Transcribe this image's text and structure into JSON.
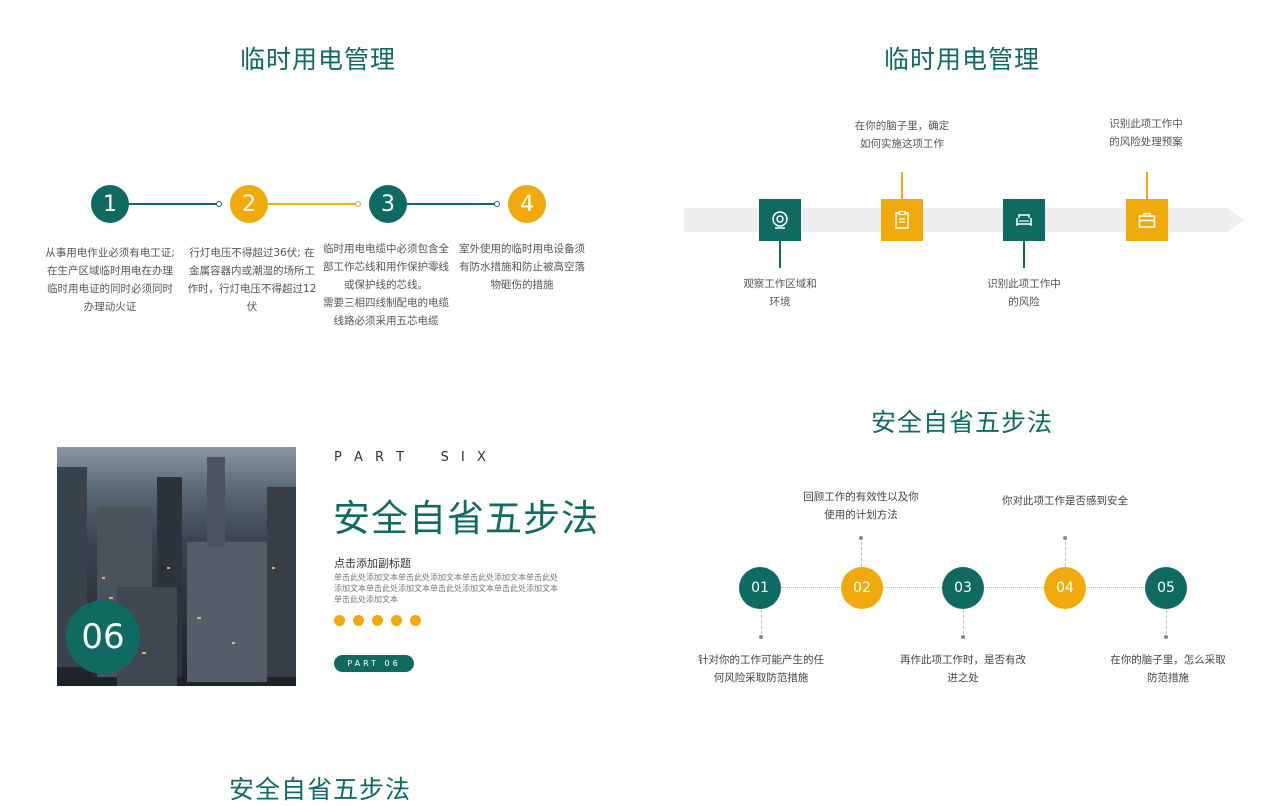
{
  "slide1": {
    "title": "临时用电管理",
    "steps": [
      {
        "num": "1",
        "text": "从事用电作业必须有电工证;\n在生产区域临时用电在办理\n临时用电证的同时必须同时\n办理动火证"
      },
      {
        "num": "2",
        "text": "行灯电压不得超过36伏; 在\n金属容器内或潮湿的场所工\n作时，行灯电压不得超过12\n伏"
      },
      {
        "num": "3",
        "text": "临时用电电缆中必须包含全\n部工作芯线和用作保护零线\n或保护线的芯线。\n需要三相四线制配电的电缆\n线路必须采用五芯电缆"
      },
      {
        "num": "4",
        "text": "室外使用的临时用电设备须\n有防水措施和防止被高空落\n物砸伤的措施"
      }
    ]
  },
  "slide2": {
    "title": "临时用电管理",
    "top_labels": [
      "在你的脑子里，确定\n如何实施这项工作",
      "识别此项工作中\n的风险处理预案"
    ],
    "bottom_labels": [
      "观察工作区域和\n环境",
      "识别此项工作中\n的风险"
    ],
    "icons": [
      "camera-icon",
      "clipboard-icon",
      "sofa-icon",
      "toolbox-icon"
    ]
  },
  "slide3": {
    "part_label": "P A R T    S I X",
    "number": "06",
    "title": "安全自省五步法",
    "subtitle": "点击添加副标题",
    "body": "单击此处添加文本单击此处添加文本单击此处添加文本单击此处添加文本单击此处添加文本单击此处添加文本单击此处添加文本单击此处添加文本",
    "badge": "PART 06",
    "photo": "city-aerial-photo"
  },
  "slide4": {
    "title": "安全自省五步法",
    "nodes": [
      "01",
      "02",
      "03",
      "04",
      "05"
    ],
    "top_labels": [
      "回顾工作的有效性以及你\n使用的计划方法",
      "你对此项工作是否感到安全"
    ],
    "bottom_labels": [
      "针对你的工作可能产生的任\n何风险采取防范措施",
      "再作此项工作时，是否有改\n进之处",
      "在你的脑子里，怎么采取\n防范措施"
    ]
  },
  "slide5": {
    "title": "安全自省五步法"
  },
  "colors": {
    "teal": "#0f6b62",
    "gold": "#f0aa0c"
  }
}
